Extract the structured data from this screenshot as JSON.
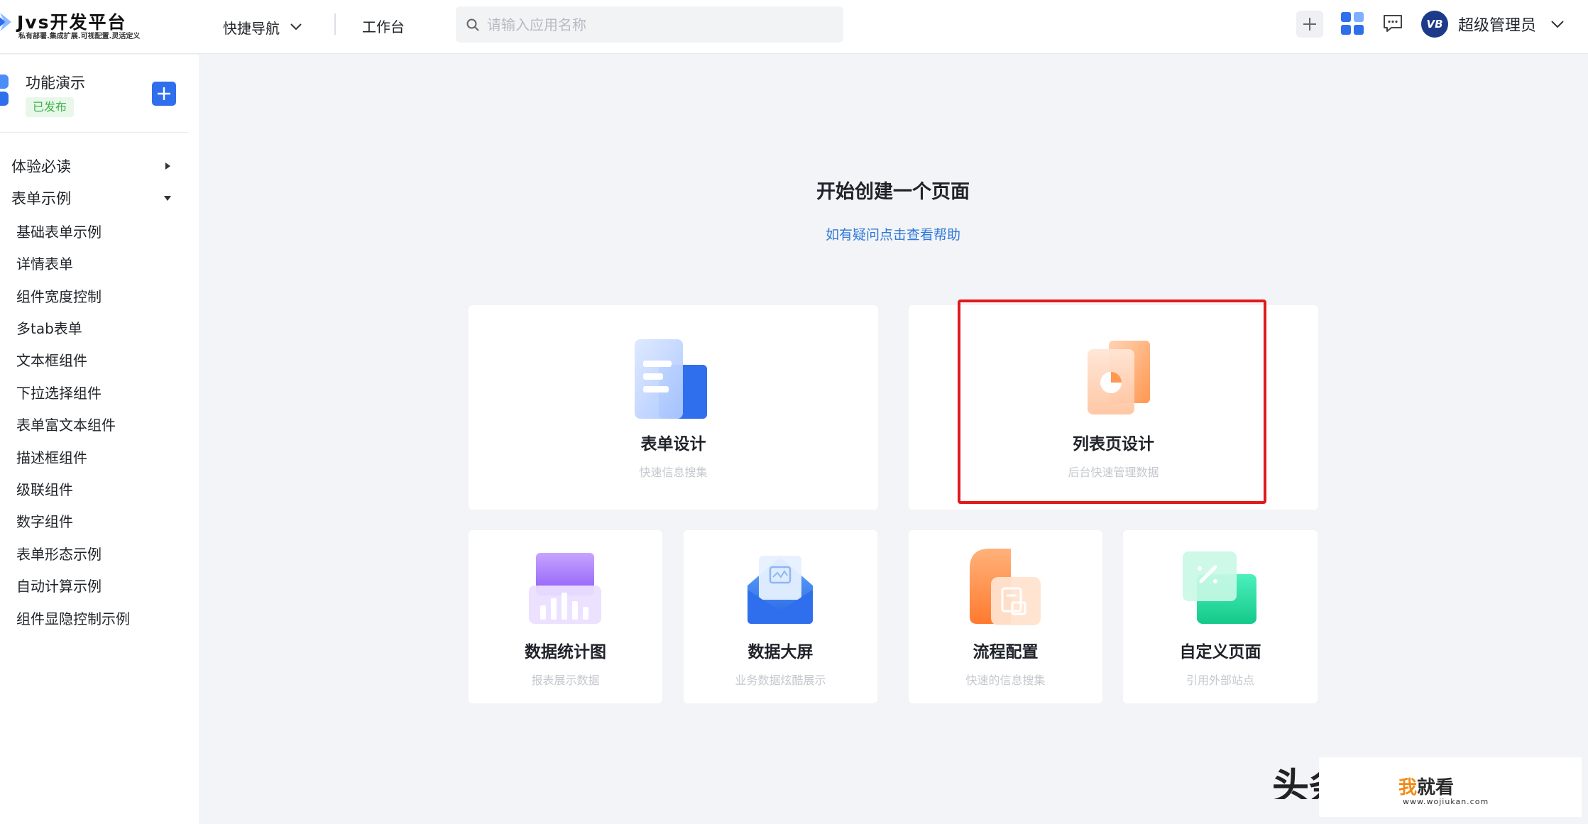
{
  "header": {
    "logo_title": "Jvs开发平台",
    "logo_subtitle": "私有部署.集成扩展.可视配置.灵活定义",
    "nav_quick": "快捷导航",
    "nav_work": "工作台",
    "search_placeholder": "请输入应用名称",
    "avatar_text": "VB",
    "user_name": "超级管理员"
  },
  "sidebar": {
    "app_name": "功能演示",
    "app_status": "已发布",
    "groups": [
      {
        "label": "体验必读",
        "state": "collapsed"
      },
      {
        "label": "表单示例",
        "state": "expanded"
      }
    ],
    "items": [
      "基础表单示例",
      "详情表单",
      "组件宽度控制",
      "多tab表单",
      "文本框组件",
      "下拉选择组件",
      "表单富文本组件",
      "描述框组件",
      "级联组件",
      "数字组件",
      "表单形态示例",
      "自动计算示例",
      "组件显隐控制示例"
    ]
  },
  "main": {
    "title": "开始创建一个页面",
    "help_link": "如有疑问点击查看帮助",
    "cards": [
      {
        "title": "表单设计",
        "subtitle": "快速信息搜集",
        "icon": "form-design-icon"
      },
      {
        "title": "列表页设计",
        "subtitle": "后台快速管理数据",
        "icon": "list-page-design-icon",
        "highlighted": true
      },
      {
        "title": "数据统计图",
        "subtitle": "报表展示数据",
        "icon": "chart-icon"
      },
      {
        "title": "数据大屏",
        "subtitle": "业务数据炫酷展示",
        "icon": "big-screen-icon"
      },
      {
        "title": "流程配置",
        "subtitle": "快速的信息搜集",
        "icon": "workflow-icon"
      },
      {
        "title": "自定义页面",
        "subtitle": "引用外部站点",
        "icon": "custom-page-icon"
      }
    ]
  },
  "watermark": {
    "left_text": "头条",
    "brand_a": "我",
    "brand_b": "就看",
    "url": "www.wojiukan.com"
  },
  "colors": {
    "accent": "#2f6fed",
    "link": "#2f78d9",
    "highlight": "#e1191c",
    "badge_green": "#3bb34a"
  }
}
